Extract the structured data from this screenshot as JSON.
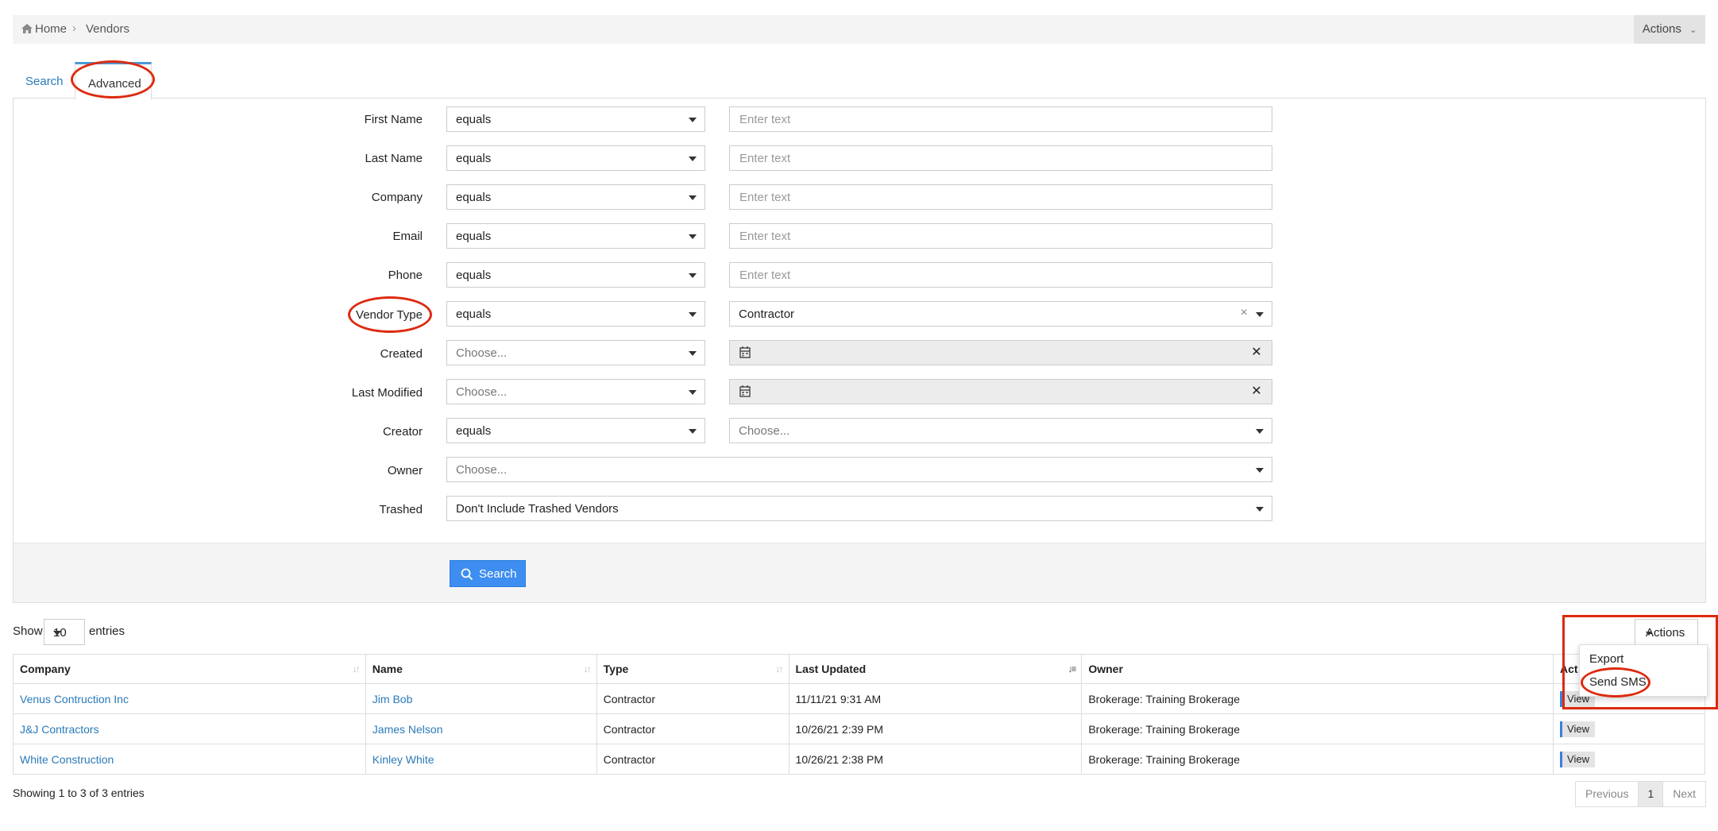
{
  "breadcrumb": {
    "home": "Home",
    "current": "Vendors",
    "actions": "Actions"
  },
  "tabs": {
    "search": "Search",
    "advanced": "Advanced"
  },
  "filters": {
    "first_name": {
      "label": "First Name",
      "op": "equals",
      "placeholder": "Enter text"
    },
    "last_name": {
      "label": "Last Name",
      "op": "equals",
      "placeholder": "Enter text"
    },
    "company": {
      "label": "Company",
      "op": "equals",
      "placeholder": "Enter text"
    },
    "email": {
      "label": "Email",
      "op": "equals",
      "placeholder": "Enter text"
    },
    "phone": {
      "label": "Phone",
      "op": "equals",
      "placeholder": "Enter text"
    },
    "vendor_type": {
      "label": "Vendor Type",
      "op": "equals",
      "value": "Contractor",
      "clear": "×"
    },
    "created": {
      "label": "Created",
      "op": "Choose...",
      "clear": "✕"
    },
    "last_modified": {
      "label": "Last Modified",
      "op": "Choose...",
      "clear": "✕"
    },
    "creator": {
      "label": "Creator",
      "op": "equals",
      "value": "Choose..."
    },
    "owner": {
      "label": "Owner",
      "value": "Choose..."
    },
    "trashed": {
      "label": "Trashed",
      "value": "Don't Include Trashed Vendors"
    }
  },
  "search_button": "Search",
  "table_controls": {
    "show": "Show",
    "length": "10",
    "entries": "entries",
    "actions": "Actions"
  },
  "actions_menu": [
    "Export",
    "Send SMS"
  ],
  "table": {
    "headers": [
      "Company",
      "Name",
      "Type",
      "Last Updated",
      "Owner",
      "Act"
    ],
    "rows": [
      {
        "company": "Venus Contruction Inc",
        "name": "Jim Bob",
        "type": "Contractor",
        "updated": "11/11/21 9:31 AM",
        "owner": "Brokerage: Training Brokerage",
        "action": "View"
      },
      {
        "company": "J&J Contractors",
        "name": "James Nelson",
        "type": "Contractor",
        "updated": "10/26/21 2:39 PM",
        "owner": "Brokerage: Training Brokerage",
        "action": "View"
      },
      {
        "company": "White Construction",
        "name": "Kinley White",
        "type": "Contractor",
        "updated": "10/26/21 2:38 PM",
        "owner": "Brokerage: Training Brokerage",
        "action": "View"
      }
    ]
  },
  "footer": {
    "info": "Showing 1 to 3 of 3 entries",
    "previous": "Previous",
    "page": "1",
    "next": "Next"
  },
  "colors": {
    "accent": "#3d8ef0",
    "link": "#2a7ab8",
    "annotation": "#dd2a0f"
  }
}
